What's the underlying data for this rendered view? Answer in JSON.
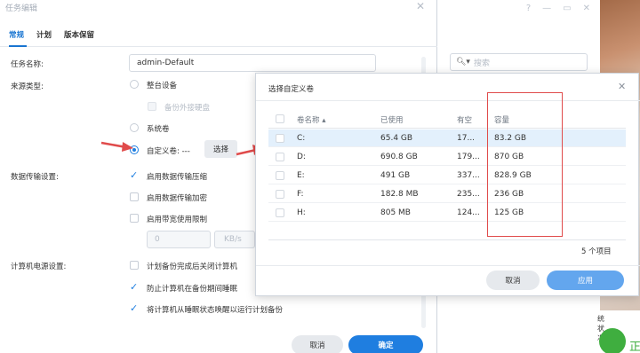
{
  "main_window": {
    "title": "任务编辑",
    "tabs": [
      {
        "label": "常规",
        "active": true
      },
      {
        "label": "计划",
        "active": false
      },
      {
        "label": "版本保留",
        "active": false
      }
    ],
    "task_name_label": "任务名称:",
    "task_name_value": "admin-Default",
    "source_type_label": "来源类型:",
    "source_options": {
      "whole_device": "整台设备",
      "backup_external": "备份外接硬盘",
      "system_volume": "系统卷",
      "custom_volume": "自定义卷: ---",
      "select_button": "选择"
    },
    "transfer_label": "数据传输设置:",
    "transfer_options": {
      "compress": "启用数据传输压缩",
      "encrypt": "启用数据传输加密",
      "bandwidth": "启用带宽使用限制"
    },
    "bandwidth_value": "0",
    "bandwidth_unit": "KB/s",
    "power_label": "计算机电源设置:",
    "power_options": {
      "shutdown": "计划备份完成后关闭计算机",
      "prevent_sleep": "防止计算机在备份期间睡眠",
      "wake": "将计算机从睡眠状态唤醒以运行计划备份"
    },
    "cancel": "取消",
    "confirm": "确定"
  },
  "background_app": {
    "search_placeholder": "搜索",
    "status_text": "统状况",
    "green_text": "正"
  },
  "modal": {
    "title": "选择自定义卷",
    "columns": [
      "卷名称 ▴",
      "已使用",
      "有空",
      "容量"
    ],
    "rows": [
      {
        "name": "C:",
        "used": "65.4 GB",
        "free": "17...",
        "capacity": "83.2 GB",
        "selected": true
      },
      {
        "name": "D:",
        "used": "690.8 GB",
        "free": "179...",
        "capacity": "870 GB",
        "selected": false
      },
      {
        "name": "E:",
        "used": "491 GB",
        "free": "337...",
        "capacity": "828.9 GB",
        "selected": false
      },
      {
        "name": "F:",
        "used": "182.8 MB",
        "free": "235...",
        "capacity": "236 GB",
        "selected": false
      },
      {
        "name": "H:",
        "used": "805 MB",
        "free": "124...",
        "capacity": "125 GB",
        "selected": false
      }
    ],
    "count": "5 个项目",
    "cancel": "取消",
    "apply": "应用"
  },
  "colors": {
    "accent": "#1f7ee0",
    "annotation_red": "#e04b4b"
  }
}
